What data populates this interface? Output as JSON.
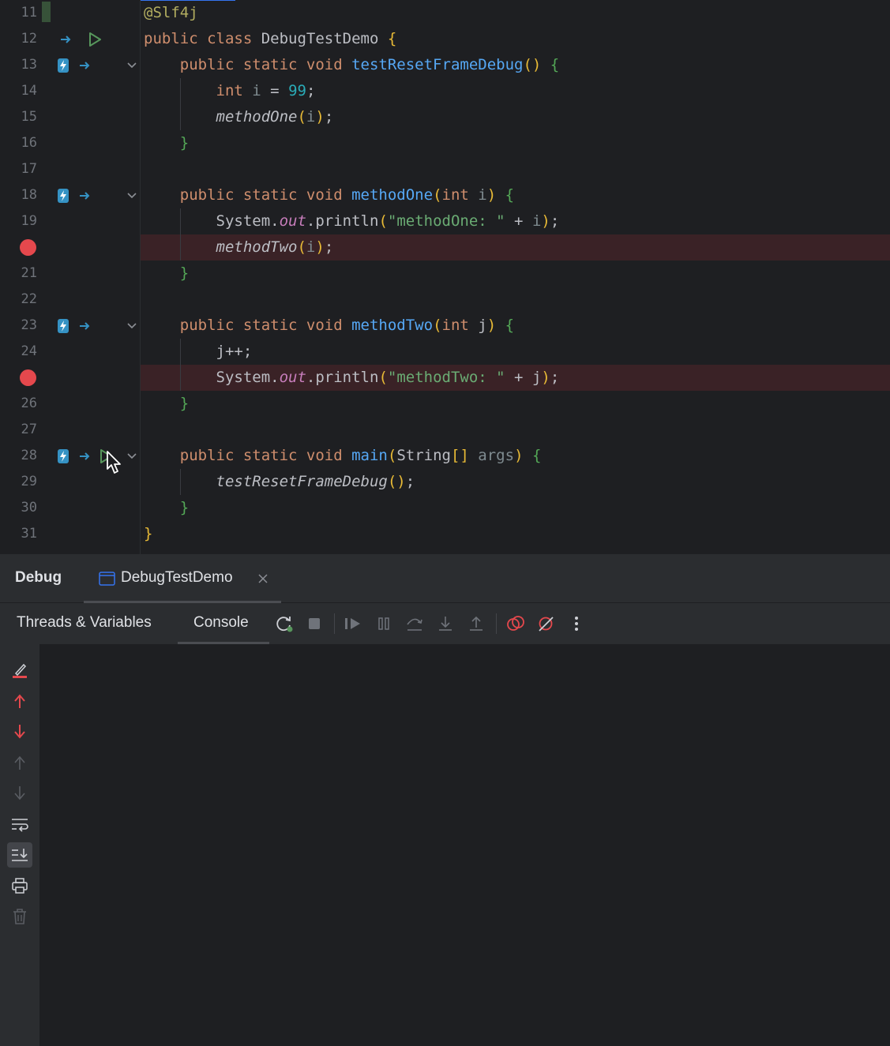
{
  "editor": {
    "lines": [
      {
        "num": "11",
        "tokens": [
          {
            "t": "@Slf4j",
            "c": "ann"
          }
        ]
      },
      {
        "num": "12",
        "tokens": [
          {
            "t": "public class ",
            "c": "kw"
          },
          {
            "t": "DebugTestDemo ",
            "c": ""
          },
          {
            "t": "{",
            "c": "b1"
          }
        ]
      },
      {
        "num": "13",
        "tokens": [
          {
            "t": "    public static void ",
            "c": "kw"
          },
          {
            "t": "testResetFrameDebug",
            "c": "fn"
          },
          {
            "t": "() ",
            "c": "b1"
          },
          {
            "t": "{",
            "c": "b2"
          }
        ]
      },
      {
        "num": "14",
        "tokens": [
          {
            "t": "        int ",
            "c": "kw"
          },
          {
            "t": "i",
            "c": "par"
          },
          {
            "t": " = ",
            "c": ""
          },
          {
            "t": "99",
            "c": "num"
          },
          {
            "t": ";",
            "c": ""
          }
        ]
      },
      {
        "num": "15",
        "tokens": [
          {
            "t": "        methodOne",
            "c": "it"
          },
          {
            "t": "(",
            "c": "b1"
          },
          {
            "t": "i",
            "c": "par"
          },
          {
            "t": ")",
            "c": "b1"
          },
          {
            "t": ";",
            "c": ""
          }
        ]
      },
      {
        "num": "16",
        "tokens": [
          {
            "t": "    }",
            "c": "b2"
          }
        ]
      },
      {
        "num": "17",
        "tokens": []
      },
      {
        "num": "18",
        "tokens": [
          {
            "t": "    public static void ",
            "c": "kw"
          },
          {
            "t": "methodOne",
            "c": "fn"
          },
          {
            "t": "(",
            "c": "b1"
          },
          {
            "t": "int ",
            "c": "kw"
          },
          {
            "t": "i",
            "c": "par"
          },
          {
            "t": ") ",
            "c": "b1"
          },
          {
            "t": "{",
            "c": "b2"
          }
        ]
      },
      {
        "num": "19",
        "tokens": [
          {
            "t": "        System.",
            "c": ""
          },
          {
            "t": "out",
            "c": "st"
          },
          {
            "t": ".println",
            "c": ""
          },
          {
            "t": "(",
            "c": "b1"
          },
          {
            "t": "\"methodOne: \"",
            "c": "str"
          },
          {
            "t": " + ",
            "c": ""
          },
          {
            "t": "i",
            "c": "par"
          },
          {
            "t": ")",
            "c": "b1"
          },
          {
            "t": ";",
            "c": ""
          }
        ]
      },
      {
        "num": "",
        "tokens": [
          {
            "t": "        methodTwo",
            "c": "it"
          },
          {
            "t": "(",
            "c": "b1"
          },
          {
            "t": "i",
            "c": "par"
          },
          {
            "t": ")",
            "c": "b1"
          },
          {
            "t": ";",
            "c": ""
          }
        ],
        "breakpoint": true
      },
      {
        "num": "21",
        "tokens": [
          {
            "t": "    }",
            "c": "b2"
          }
        ]
      },
      {
        "num": "22",
        "tokens": []
      },
      {
        "num": "23",
        "tokens": [
          {
            "t": "    public static void ",
            "c": "kw"
          },
          {
            "t": "methodTwo",
            "c": "fn"
          },
          {
            "t": "(",
            "c": "b1"
          },
          {
            "t": "int ",
            "c": "kw"
          },
          {
            "t": "j",
            "c": ""
          },
          {
            "t": ") ",
            "c": "b1"
          },
          {
            "t": "{",
            "c": "b2"
          }
        ]
      },
      {
        "num": "24",
        "tokens": [
          {
            "t": "        j++;",
            "c": ""
          }
        ]
      },
      {
        "num": "",
        "tokens": [
          {
            "t": "        System.",
            "c": ""
          },
          {
            "t": "out",
            "c": "st"
          },
          {
            "t": ".println",
            "c": ""
          },
          {
            "t": "(",
            "c": "b1"
          },
          {
            "t": "\"methodTwo: \"",
            "c": "str"
          },
          {
            "t": " + ",
            "c": ""
          },
          {
            "t": "j",
            "c": ""
          },
          {
            "t": ")",
            "c": "b1"
          },
          {
            "t": ";",
            "c": ""
          }
        ],
        "breakpoint": true
      },
      {
        "num": "26",
        "tokens": [
          {
            "t": "    }",
            "c": "b2"
          }
        ]
      },
      {
        "num": "27",
        "tokens": []
      },
      {
        "num": "28",
        "tokens": [
          {
            "t": "    public static void ",
            "c": "kw"
          },
          {
            "t": "main",
            "c": "fn"
          },
          {
            "t": "(",
            "c": "b1"
          },
          {
            "t": "String",
            "c": ""
          },
          {
            "t": "[] ",
            "c": "b1"
          },
          {
            "t": "args",
            "c": "par"
          },
          {
            "t": ") ",
            "c": "b1"
          },
          {
            "t": "{",
            "c": "b2"
          }
        ]
      },
      {
        "num": "29",
        "tokens": [
          {
            "t": "        testResetFrameDebug",
            "c": "it"
          },
          {
            "t": "()",
            "c": "b1"
          },
          {
            "t": ";",
            "c": ""
          }
        ]
      },
      {
        "num": "30",
        "tokens": [
          {
            "t": "    }",
            "c": "b2"
          }
        ]
      },
      {
        "num": "31",
        "tokens": [
          {
            "t": "}",
            "c": "b1"
          }
        ]
      }
    ]
  },
  "debug": {
    "title": "Debug",
    "session_tab": "DebugTestDemo",
    "subtabs": [
      "Threads & Variables",
      "Console"
    ],
    "active_subtab": "Console"
  },
  "colors": {
    "breakpoint": "#e5484d",
    "breakpoint_line": "#3a2226",
    "run_icon": "#57965c",
    "accent": "#3574f0"
  }
}
